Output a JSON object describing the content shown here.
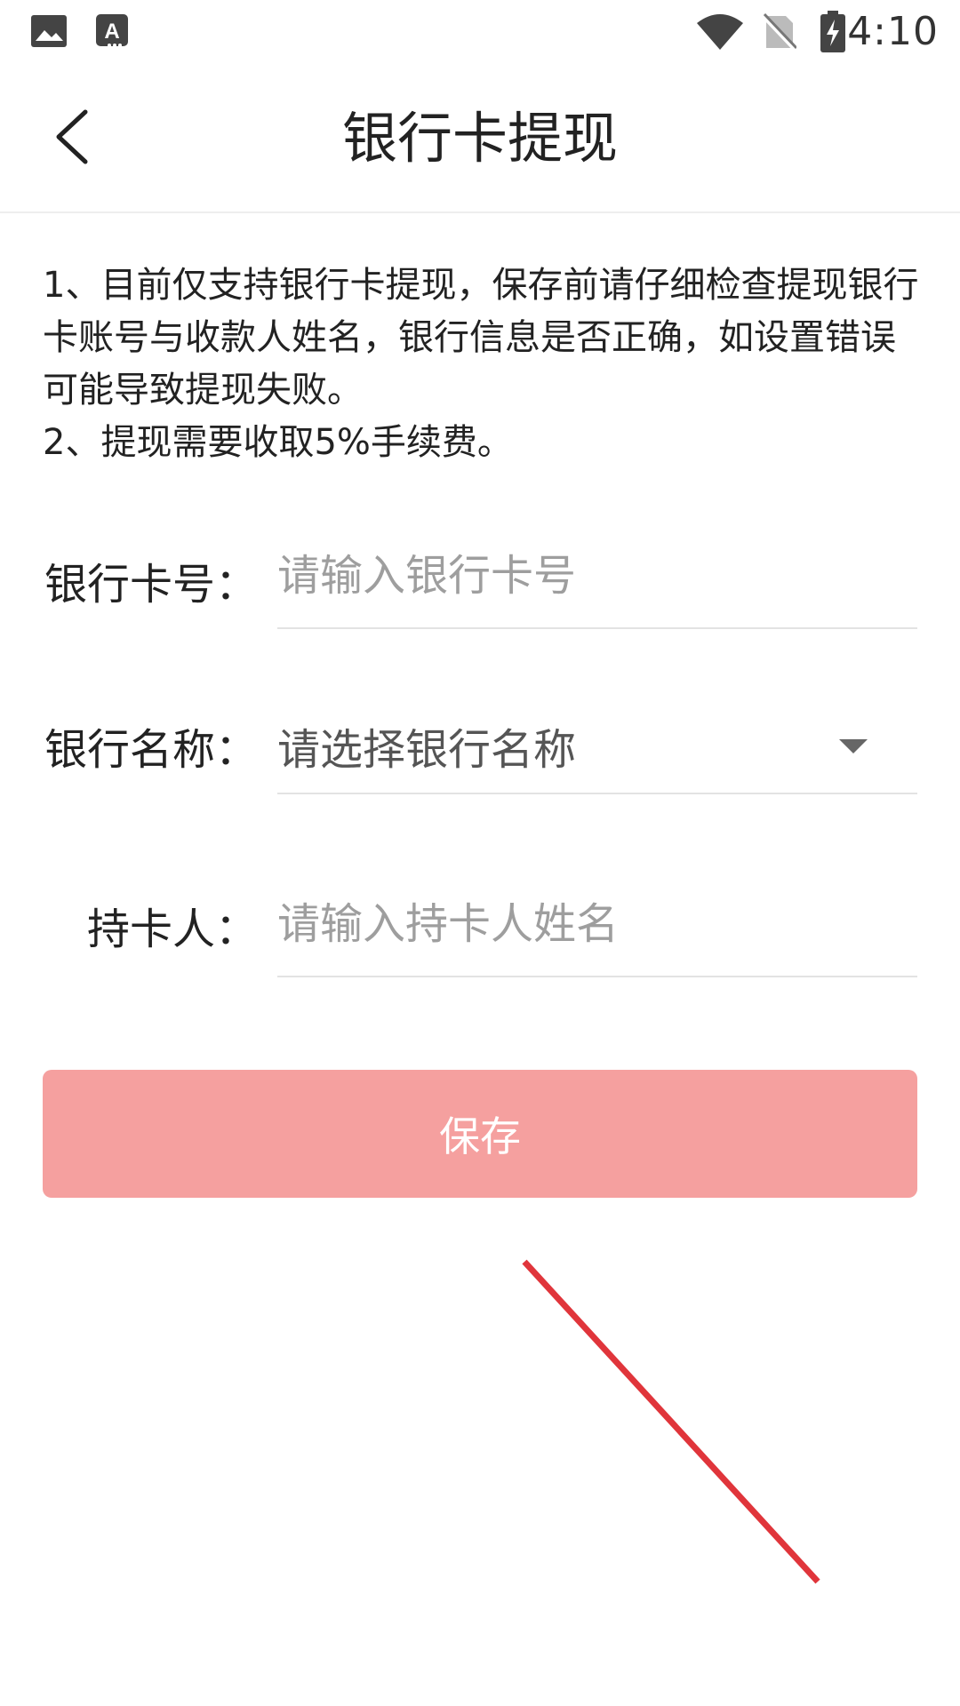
{
  "status_bar": {
    "time": "4:10",
    "icons": [
      "gallery-icon",
      "text-recognition-icon",
      "wifi-icon",
      "no-sim-icon",
      "battery-charging-icon"
    ]
  },
  "header": {
    "title": "银行卡提现",
    "back_icon": "chevron-left-icon"
  },
  "notice": {
    "line1": "1、目前仅支持银行卡提现，保存前请仔细检查提现银行卡账号与收款人姓名，银行信息是否正确，如设置错误可能导致提现失败。",
    "line2": "2、提现需要收取5%手续费。"
  },
  "form": {
    "card_number": {
      "label": "银行卡号：",
      "value": "",
      "placeholder": "请输入银行卡号"
    },
    "bank_name": {
      "label": "银行名称：",
      "selected": "请选择银行名称",
      "icon": "dropdown-arrow-icon"
    },
    "holder": {
      "label": "持卡人：",
      "value": "",
      "placeholder": "请输入持卡人姓名"
    }
  },
  "actions": {
    "save_label": "保存"
  },
  "colors": {
    "primary_button": "#f5a09f",
    "annotation_line": "#e0353b",
    "divider": "#e3e3e3"
  }
}
